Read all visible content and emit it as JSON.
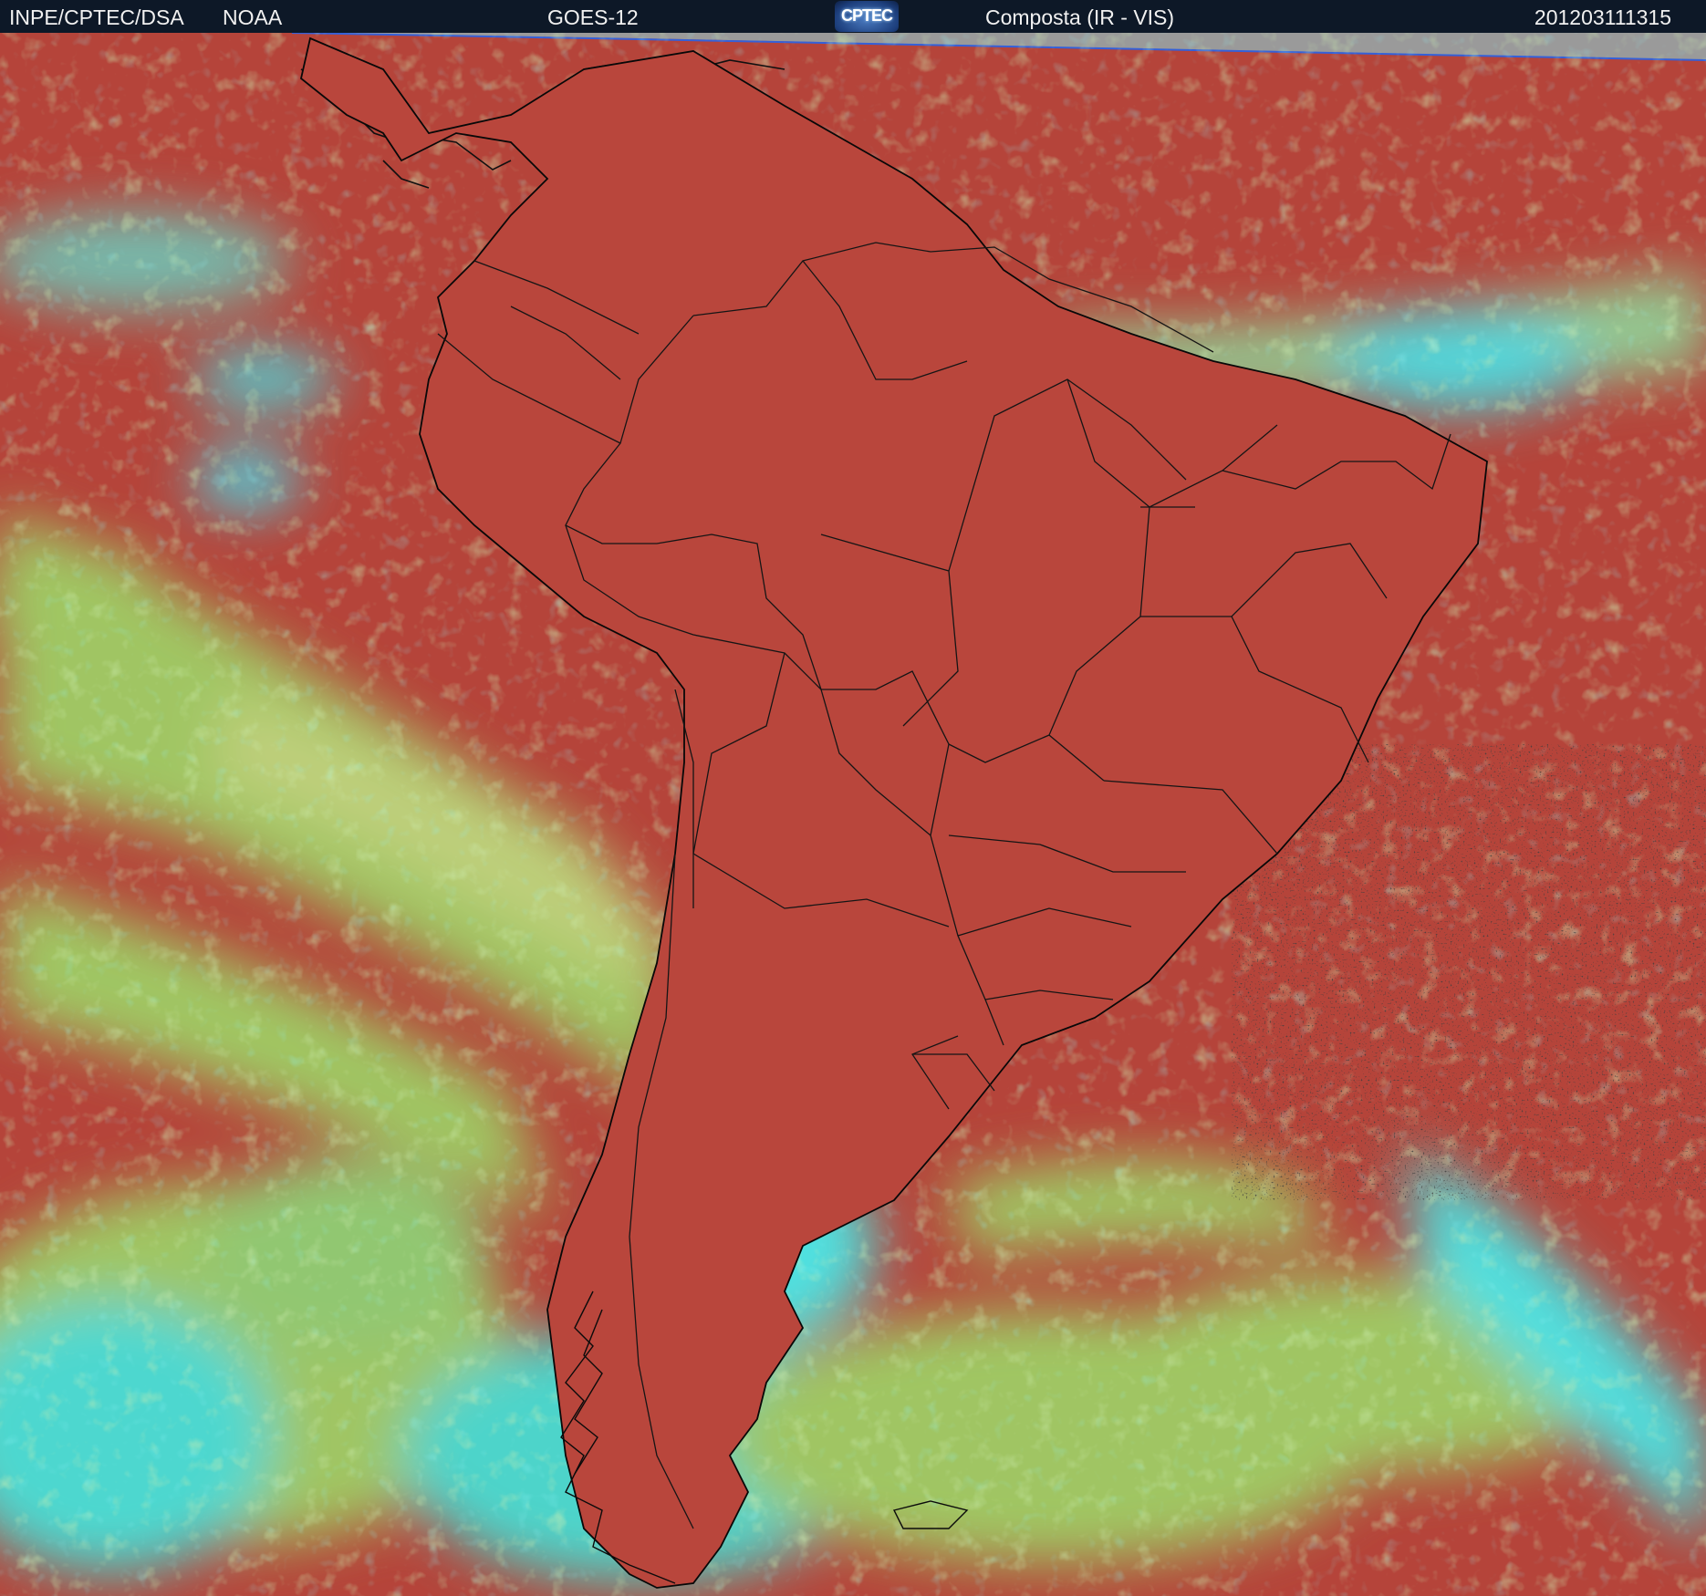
{
  "header": {
    "agency": "INPE/CPTEC/DSA",
    "source": "NOAA",
    "satellite": "GOES-12",
    "logo_text": "CPTEC",
    "product": "Composta (IR - VIS)",
    "timestamp": "201203111315"
  },
  "colors": {
    "clear_surface": "#b5443a",
    "warm_land": "#cc4a28",
    "low_cloud": "#9ed467",
    "high_cloud": "#3ff0f0",
    "mid_cloud": "#6f90c8",
    "coastline": "#000000",
    "no_data": "#9a9a9a"
  }
}
